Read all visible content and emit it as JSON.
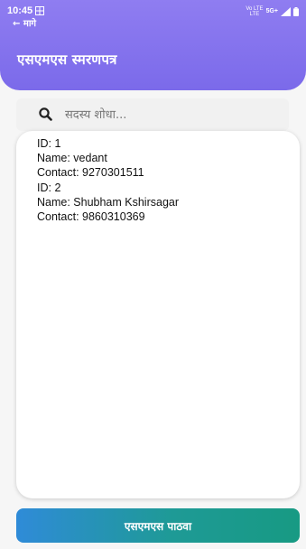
{
  "status_bar": {
    "time": "10:45",
    "back_label": "← मागे",
    "network_top": "Vo LTE",
    "network_gen": "5G+",
    "network_sub": "LTE"
  },
  "header": {
    "title": "एसएमएस स्मरणपत्र"
  },
  "search": {
    "placeholder": "सदस्य शोधा...",
    "value": ""
  },
  "members": [
    {
      "id": "ID: 1",
      "name": "Name: vedant",
      "contact": "Contact: 9270301511"
    },
    {
      "id": "ID: 2",
      "name": "Name: Shubham Kshirsagar",
      "contact": "Contact: 9860310369"
    }
  ],
  "actions": {
    "send_label": "एसएमएस पाठवा"
  },
  "colors": {
    "header": "#8f7df1",
    "button_start": "#2f8bd8",
    "button_end": "#179a83"
  }
}
